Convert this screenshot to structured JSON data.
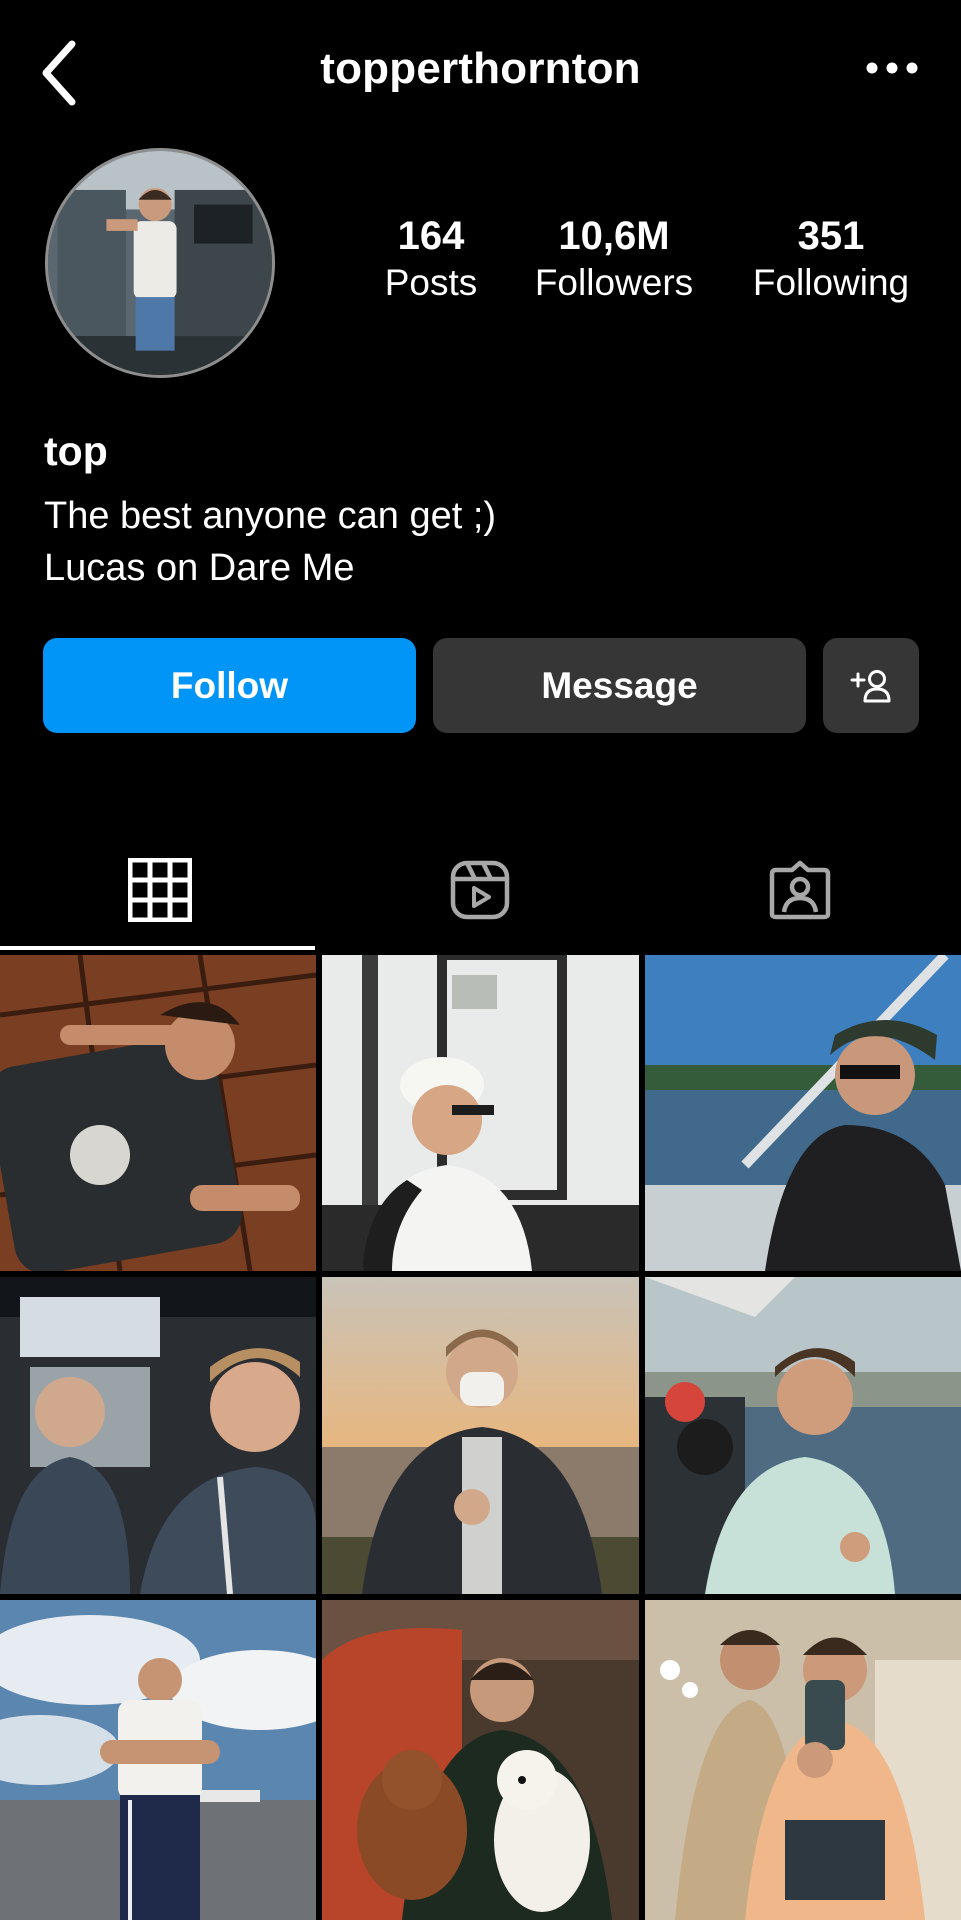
{
  "header": {
    "username": "topperthornton",
    "back_icon": "chevron-left-icon",
    "more_icon": "more-horizontal-icon"
  },
  "stats": [
    {
      "value": "164",
      "label": "Posts"
    },
    {
      "value": "10,6M",
      "label": "Followers"
    },
    {
      "value": "351",
      "label": "Following"
    }
  ],
  "profile": {
    "name": "top",
    "bio_lines": [
      "The best anyone can get ;)",
      "Lucas on Dare Me"
    ]
  },
  "actions": {
    "follow_label": "Follow",
    "message_label": "Message",
    "add_user_icon": "add-user-icon"
  },
  "tabs": [
    {
      "name": "posts",
      "icon": "grid-icon",
      "active": true
    },
    {
      "name": "reels",
      "icon": "reels-icon",
      "active": false
    },
    {
      "name": "tagged",
      "icon": "tagged-icon",
      "active": false
    }
  ],
  "colors": {
    "background": "#000000",
    "accent_blue": "#0095f6",
    "secondary_button": "#363636"
  },
  "grid": {
    "columns": 3,
    "posts": [
      {
        "index": 1,
        "scene": "brown-tiles-lying-down"
      },
      {
        "index": 2,
        "scene": "white-cap-trailer-door"
      },
      {
        "index": 3,
        "scene": "boat-lake-sunglasses"
      },
      {
        "index": 4,
        "scene": "car-selfie-two"
      },
      {
        "index": 5,
        "scene": "sunset-mask-thumbs-up"
      },
      {
        "index": 6,
        "scene": "lake-film-crew"
      },
      {
        "index": 7,
        "scene": "airstrip-cloudy-sky"
      },
      {
        "index": 8,
        "scene": "couch-with-dogs"
      },
      {
        "index": 9,
        "scene": "mirror-selfie-two"
      }
    ]
  }
}
